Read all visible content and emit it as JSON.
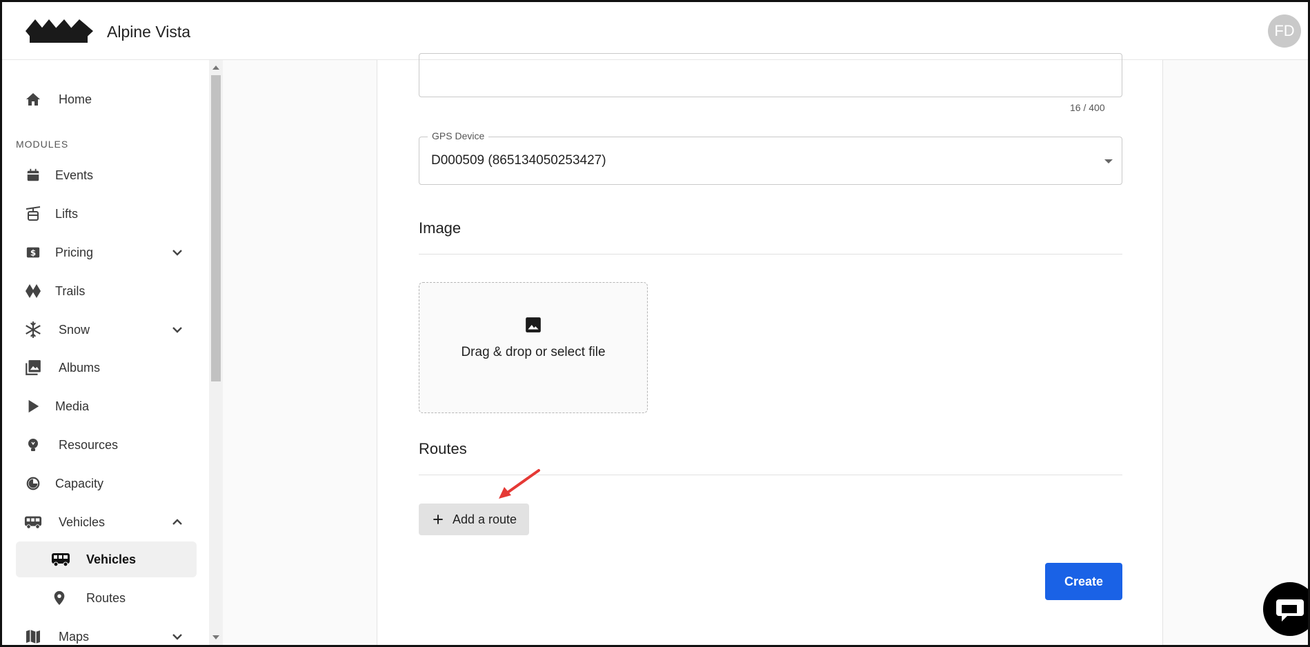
{
  "app": {
    "brand": "Alpine Vista",
    "user_initials": "FD"
  },
  "sidebar": {
    "home": "Home",
    "modules_label": "MODULES",
    "items": [
      {
        "label": "Events",
        "icon": "calendar-icon"
      },
      {
        "label": "Lifts",
        "icon": "gondola-icon"
      },
      {
        "label": "Pricing",
        "icon": "dollar-icon",
        "expandable": true
      },
      {
        "label": "Trails",
        "icon": "diamond-icon"
      },
      {
        "label": "Snow",
        "icon": "snowflake-icon",
        "expandable": true
      },
      {
        "label": "Albums",
        "icon": "photo-library-icon"
      },
      {
        "label": "Media",
        "icon": "play-icon"
      },
      {
        "label": "Resources",
        "icon": "lightbulb-icon"
      },
      {
        "label": "Capacity",
        "icon": "gauge-icon"
      },
      {
        "label": "Vehicles",
        "icon": "bus-icon",
        "expanded": true
      },
      {
        "label": "Maps",
        "icon": "map-icon",
        "expandable": true
      }
    ],
    "sub_items": [
      {
        "label": "Vehicles",
        "icon": "bus-icon",
        "active": true
      },
      {
        "label": "Routes",
        "icon": "location-pin-icon"
      }
    ]
  },
  "form": {
    "description_counter": "16 / 400",
    "gps": {
      "label": "GPS Device",
      "value": "D000509 (865134050253427)"
    },
    "image_section": "Image",
    "dropzone_text": "Drag & drop or select file",
    "routes_section": "Routes",
    "add_route_label": "Add a route",
    "create_label": "Create"
  },
  "colors": {
    "primary": "#1a62e6",
    "annotation_arrow": "#e53935"
  }
}
